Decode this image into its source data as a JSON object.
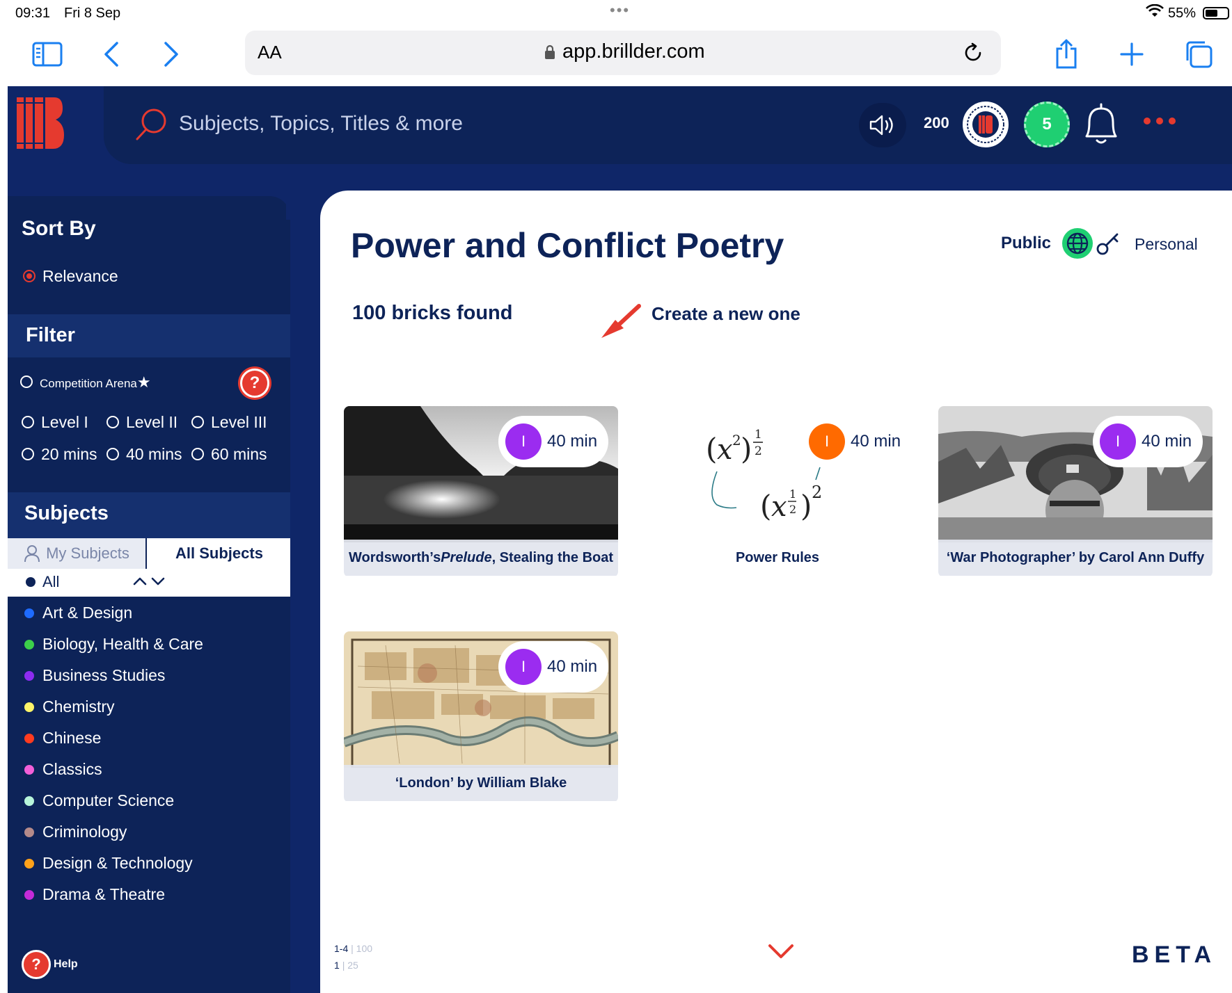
{
  "status_bar": {
    "time": "09:31",
    "date": "Fri 8 Sep",
    "battery": "55%"
  },
  "browser": {
    "aa_label": "AA",
    "url": "app.brillder.com"
  },
  "header": {
    "search_placeholder": "Subjects, Topics, Titles & more",
    "points": "200",
    "level": "5"
  },
  "sidebar": {
    "sort_by": "Sort By",
    "relevance": "Relevance",
    "filter": "Filter",
    "competition_arena": "Competition Arena",
    "levels": [
      "Level I",
      "Level II",
      "Level III"
    ],
    "durations": [
      "20 mins",
      "40 mins",
      "60 mins"
    ],
    "subjects_heading": "Subjects",
    "tab_my": "My Subjects",
    "tab_all": "All Subjects",
    "all": "All",
    "subjects": [
      {
        "name": "Art & Design",
        "color": "#1e6bff"
      },
      {
        "name": "Biology, Health & Care",
        "color": "#3ccf4a"
      },
      {
        "name": "Business Studies",
        "color": "#8d2cf0"
      },
      {
        "name": "Chemistry",
        "color": "#fff569"
      },
      {
        "name": "Chinese",
        "color": "#ff3b1f"
      },
      {
        "name": "Classics",
        "color": "#f25fd8"
      },
      {
        "name": "Computer Science",
        "color": "#b7f5da"
      },
      {
        "name": "Criminology",
        "color": "#b48a8a"
      },
      {
        "name": "Design & Technology",
        "color": "#ffa21a"
      },
      {
        "name": "Drama & Theatre",
        "color": "#c42bd8"
      }
    ],
    "help": "Help"
  },
  "main": {
    "title": "Power and Conflict Poetry",
    "public": "Public",
    "personal": "Personal",
    "bricks_found": "100 bricks found",
    "create_new": "Create a new one",
    "cards": [
      {
        "caption_a": "Wordsworth’s ",
        "caption_em": "Prelude",
        "caption_b": ", Stealing the Boat",
        "level": "I",
        "duration": "40 min",
        "level_color": "#9b2cf0"
      },
      {
        "caption": "Power Rules",
        "level": "I",
        "duration": "40 min",
        "level_color": "#ff6a00"
      },
      {
        "caption": "‘War Photographer’ by Carol Ann Duffy",
        "level": "I",
        "duration": "40 min",
        "level_color": "#9b2cf0"
      },
      {
        "caption": "‘London’ by William Blake",
        "level": "I",
        "duration": "40 min",
        "level_color": "#9b2cf0"
      }
    ],
    "pagination": {
      "range": "1-4",
      "total": "100",
      "page": "1",
      "pages": "25"
    },
    "beta": "BETA"
  },
  "colors": {
    "navy": "#0f2668",
    "accent_red": "#e53a2f",
    "green": "#1fcf72"
  }
}
